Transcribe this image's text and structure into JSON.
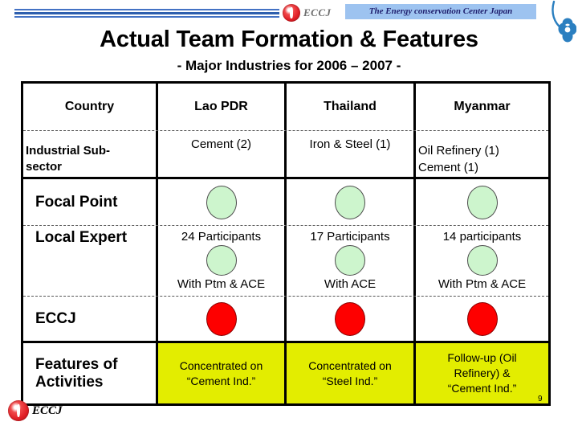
{
  "header": {
    "brand_abbrev": "ECCJ",
    "tagline": "The Energy conservation Center Japan",
    "logo_icon": "eccj-globe-icon",
    "clover_icon": "blue-clover-icon"
  },
  "title": "Actual Team Formation & Features",
  "subtitle": "- Major Industries for 2006 – 2007 -",
  "colors": {
    "accent_blue": "#4472c4",
    "tagline_bg": "#9dc3f0",
    "logo_red": "#e21f26",
    "green_dot": "#cdf5cd",
    "red_dot": "#fe0000",
    "yellow_cell": "#e3ed00",
    "border": "#000000"
  },
  "table": {
    "columns": [
      "Country",
      "Lao PDR",
      "Thailand",
      "Myanmar"
    ],
    "rows": [
      {
        "label": "Industrial Sub-sector",
        "cells": [
          "Cement (2)",
          "Iron & Steel (1)",
          "Oil Refinery (1)\nCement (1)"
        ]
      },
      {
        "label": "Focal Point",
        "marker": "green-circle"
      },
      {
        "label": "Local Expert",
        "participants": [
          "24 Participants",
          "17 Participants",
          "14 participants"
        ],
        "partners": [
          "With Ptm & ACE",
          "With ACE",
          "With Ptm & ACE"
        ],
        "marker": "green-circle"
      },
      {
        "label": "ECCJ",
        "marker": "red-circle"
      },
      {
        "label": "Features of Activities",
        "cells": [
          "Concentrated on “Cement Ind.”",
          "Concentrated on “Steel Ind.”",
          "Follow-up (Oil Refinery) & “Cement Ind.”"
        ]
      }
    ],
    "subsector_myanmar_line1": "Oil Refinery (1)",
    "subsector_myanmar_line2": "Cement (1)",
    "label_subsector_line1": "Industrial Sub-",
    "label_subsector_line2": "sector",
    "label_features_line1": "Features of",
    "label_features_line2": "Activities",
    "feat_lao_line1": "Concentrated on",
    "feat_lao_line2": "“Cement Ind.”",
    "feat_thai_line1": "Concentrated on",
    "feat_thai_line2": "“Steel Ind.”",
    "feat_mya_line1": "Follow-up (Oil",
    "feat_mya_line2": "Refinery) &",
    "feat_mya_line3": "“Cement Ind.”"
  },
  "footer": {
    "brand": "ECCJ",
    "logo_icon": "eccj-globe-icon",
    "page_number": "9"
  }
}
